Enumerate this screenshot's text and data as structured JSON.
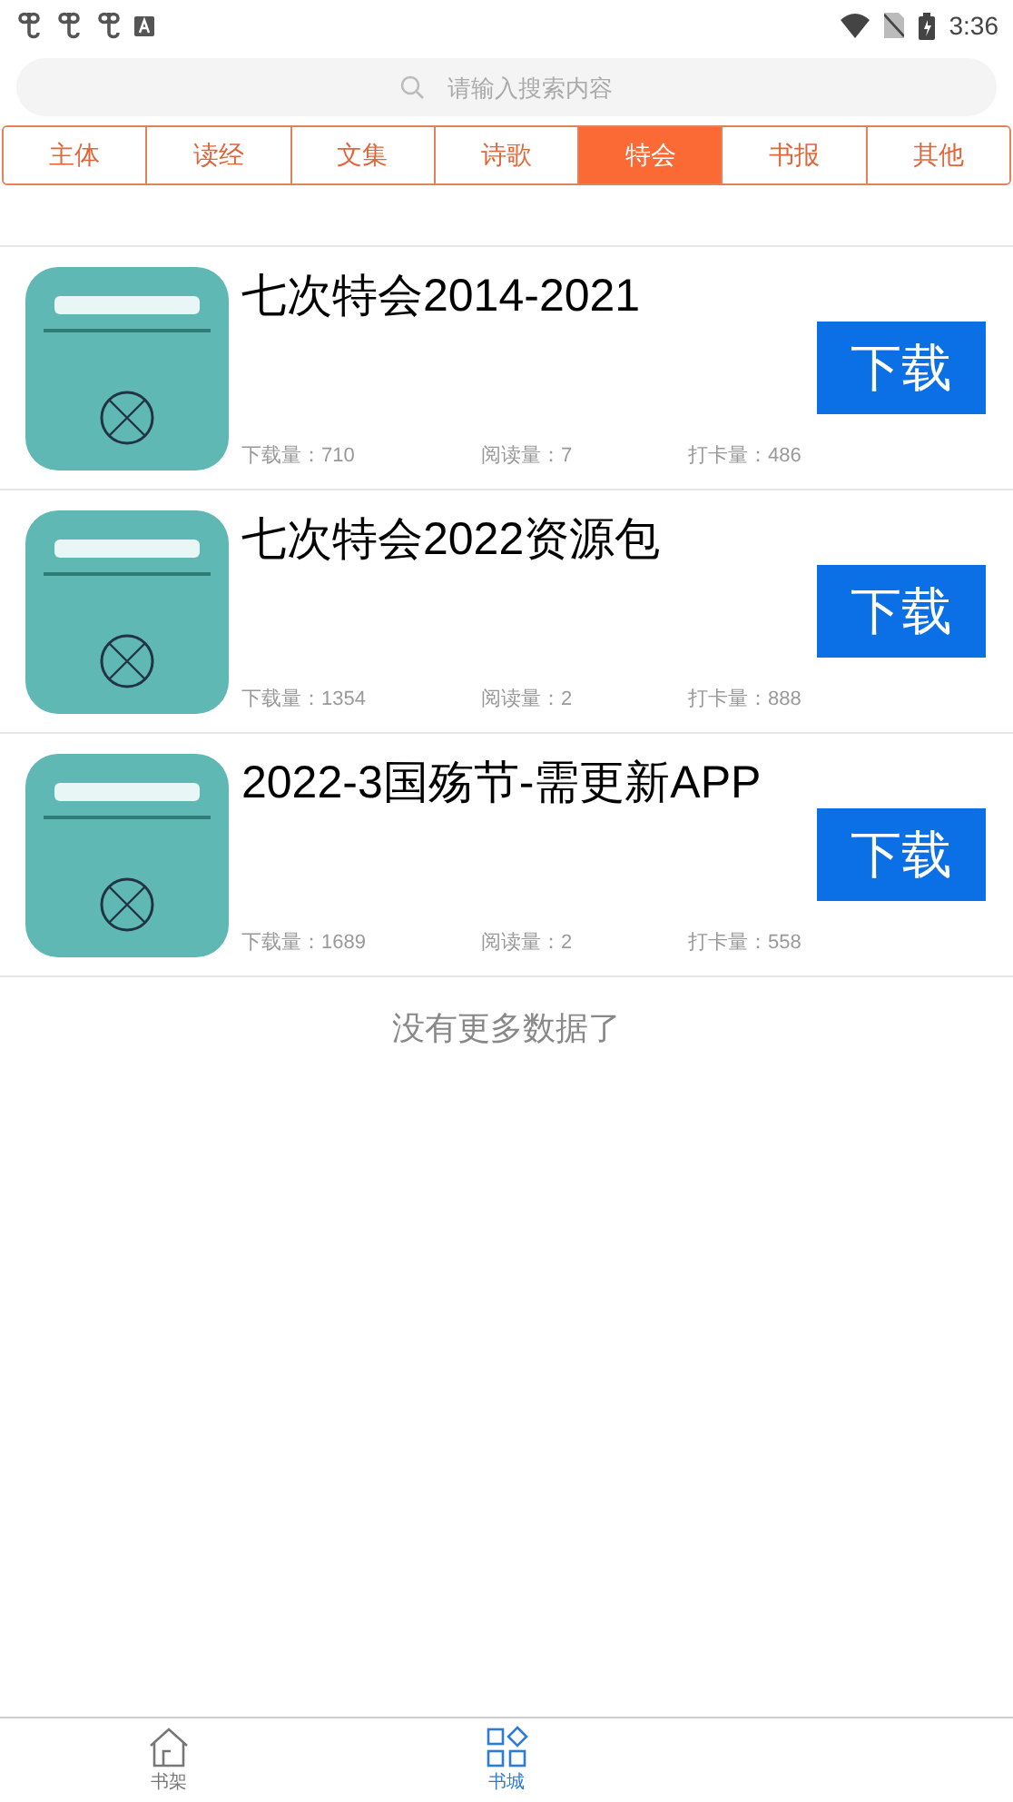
{
  "status_bar": {
    "time": "3:36"
  },
  "search": {
    "placeholder": "请输入搜索内容"
  },
  "tabs": [
    {
      "label": "主体",
      "selected": false
    },
    {
      "label": "读经",
      "selected": false
    },
    {
      "label": "文集",
      "selected": false
    },
    {
      "label": "诗歌",
      "selected": false
    },
    {
      "label": "特会",
      "selected": true
    },
    {
      "label": "书报",
      "selected": false
    },
    {
      "label": "其他",
      "selected": false
    }
  ],
  "items": [
    {
      "title": "七次特会2014-2021",
      "button": "下载",
      "downloads": "下载量：710",
      "reads": "阅读量：7",
      "checkins": "打卡量：486"
    },
    {
      "title": "七次特会2022资源包",
      "button": "下载",
      "downloads": "下载量：1354",
      "reads": "阅读量：2",
      "checkins": "打卡量：888"
    },
    {
      "title": "2022-3国殇节-需更新APP",
      "button": "下载",
      "downloads": "下载量：1689",
      "reads": "阅读量：2",
      "checkins": "打卡量：558"
    }
  ],
  "end_note": "没有更多数据了",
  "bottom_nav": [
    {
      "label": "书架",
      "kind": "home",
      "selected": false
    },
    {
      "label": "书城",
      "kind": "grid",
      "selected": true
    }
  ]
}
